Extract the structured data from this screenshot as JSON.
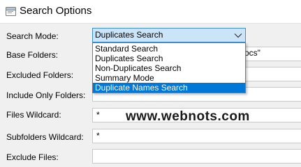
{
  "window": {
    "title": "Search Options",
    "icon": "window-icon"
  },
  "labels": {
    "search_mode": "Search Mode:",
    "base_folders": "Base Folders:",
    "excluded_folders": "Excluded Folders:",
    "include_only_folders": "Include Only Folders:",
    "files_wildcard": "Files Wildcard:",
    "subfolders_wildcard": "Subfolders Wildcard:",
    "exclude_files": "Exclude Files:"
  },
  "search_mode": {
    "selected": "Duplicates Search",
    "options": [
      "Standard Search",
      "Duplicates Search",
      "Non-Duplicates Search",
      "Summary Mode",
      "Duplicate Names Search"
    ],
    "highlighted_option": "Duplicate Names Search"
  },
  "fields": {
    "base_folders_value": "ocs\"",
    "files_wildcard_value": "*",
    "subfolders_wildcard_value": "*",
    "exclude_files_value": ""
  },
  "watermark": "www.webnots.com",
  "colors": {
    "select_bg": "#cce4f7",
    "select_border": "#3d8fd1",
    "highlight": "#0078d7"
  }
}
